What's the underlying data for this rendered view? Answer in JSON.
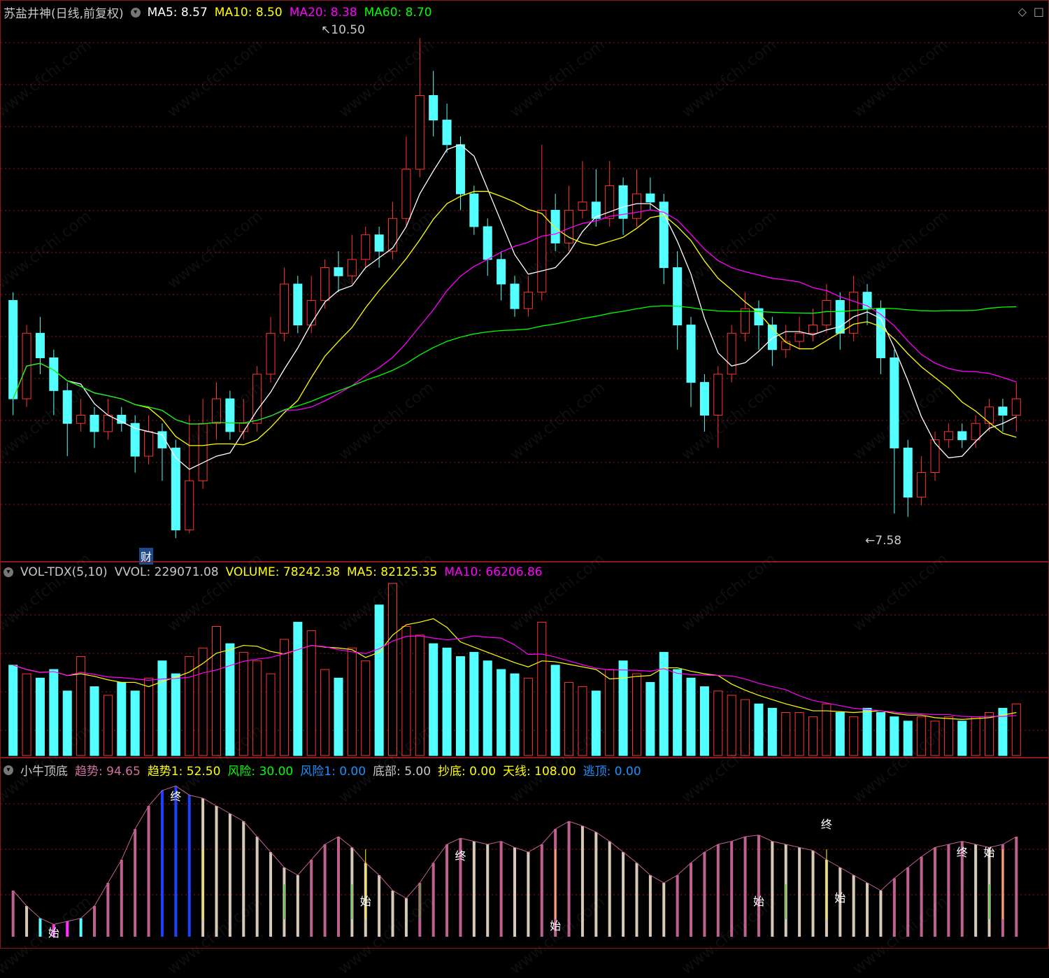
{
  "price_panel": {
    "title": "苏盐井神(日线,前复权)",
    "ma": [
      {
        "label": "MA5:",
        "value": "8.57",
        "color": "#ffffff"
      },
      {
        "label": "MA10:",
        "value": "8.50",
        "color": "#ffff00"
      },
      {
        "label": "MA20:",
        "value": "8.38",
        "color": "#ff00ff"
      },
      {
        "label": "MA60:",
        "value": "8.70",
        "color": "#00ff00"
      }
    ],
    "high_label": "10.50",
    "low_label": "7.58",
    "marker_cai": "财"
  },
  "vol_panel": {
    "title": "VOL-TDX(5,10)",
    "items": [
      {
        "label": "VVOL:",
        "value": "229071.08",
        "color": "#c8c8c8"
      },
      {
        "label": "VOLUME:",
        "value": "78242.38",
        "color": "#ffff00"
      },
      {
        "label": "MA5:",
        "value": "82125.35",
        "color": "#ffff00"
      },
      {
        "label": "MA10:",
        "value": "66206.86",
        "color": "#ff00ff"
      }
    ]
  },
  "ind_panel": {
    "title": "小牛顶底",
    "items": [
      {
        "label": "趋势:",
        "value": "94.65",
        "color": "#d070a0"
      },
      {
        "label": "趋势1:",
        "value": "52.50",
        "color": "#ffff00"
      },
      {
        "label": "风险:",
        "value": "30.00",
        "color": "#00ff00"
      },
      {
        "label": "风险1:",
        "value": "0.00",
        "color": "#1e90ff"
      },
      {
        "label": "底部:",
        "value": "5.00",
        "color": "#c8c8c8"
      },
      {
        "label": "抄底:",
        "value": "0.00",
        "color": "#ffff00"
      },
      {
        "label": "天线:",
        "value": "108.00",
        "color": "#ffff00"
      },
      {
        "label": "逃顶:",
        "value": "0.00",
        "color": "#1e90ff"
      }
    ],
    "marker_start": "始",
    "marker_end": "终"
  },
  "watermark": "www.cfchi.com",
  "colors": {
    "up": "#ff3232",
    "down": "#54ffff",
    "grid": "#8b1a1a"
  },
  "chart_data": {
    "type": "candlestick",
    "ylim": [
      7.4,
      10.6
    ],
    "candles": [
      [
        8.9,
        8.3,
        8.95,
        8.2
      ],
      [
        8.3,
        8.7,
        8.75,
        8.25
      ],
      [
        8.7,
        8.55,
        8.8,
        8.45
      ],
      [
        8.55,
        8.35,
        8.6,
        8.2
      ],
      [
        8.35,
        8.15,
        8.4,
        7.95
      ],
      [
        8.15,
        8.2,
        8.3,
        8.1
      ],
      [
        8.2,
        8.1,
        8.25,
        8.0
      ],
      [
        8.1,
        8.2,
        8.3,
        8.05
      ],
      [
        8.2,
        8.15,
        8.25,
        8.1
      ],
      [
        8.15,
        7.95,
        8.2,
        7.85
      ],
      [
        7.95,
        8.1,
        8.2,
        7.9
      ],
      [
        8.1,
        8.0,
        8.15,
        7.8
      ],
      [
        8.0,
        7.5,
        8.05,
        7.45
      ],
      [
        7.5,
        7.8,
        8.2,
        7.48
      ],
      [
        7.8,
        8.15,
        8.3,
        7.75
      ],
      [
        8.15,
        8.3,
        8.4,
        8.05
      ],
      [
        8.3,
        8.1,
        8.35,
        8.05
      ],
      [
        8.1,
        8.15,
        8.3,
        8.05
      ],
      [
        8.15,
        8.45,
        8.5,
        8.1
      ],
      [
        8.45,
        8.7,
        8.8,
        8.4
      ],
      [
        8.7,
        9.0,
        9.1,
        8.65
      ],
      [
        9.0,
        8.75,
        9.05,
        8.7
      ],
      [
        8.75,
        8.9,
        9.05,
        8.7
      ],
      [
        8.9,
        9.1,
        9.15,
        8.85
      ],
      [
        9.1,
        9.05,
        9.2,
        8.95
      ],
      [
        9.05,
        9.15,
        9.3,
        9.0
      ],
      [
        9.15,
        9.3,
        9.35,
        9.1
      ],
      [
        9.3,
        9.2,
        9.35,
        9.1
      ],
      [
        9.2,
        9.4,
        9.5,
        9.15
      ],
      [
        9.4,
        9.7,
        9.9,
        9.35
      ],
      [
        9.7,
        10.15,
        10.5,
        9.65
      ],
      [
        10.15,
        10.0,
        10.3,
        9.9
      ],
      [
        10.0,
        9.85,
        10.1,
        9.8
      ],
      [
        9.85,
        9.55,
        9.9,
        9.45
      ],
      [
        9.55,
        9.35,
        9.6,
        9.3
      ],
      [
        9.35,
        9.15,
        9.4,
        9.05
      ],
      [
        9.15,
        9.0,
        9.2,
        8.9
      ],
      [
        9.0,
        8.85,
        9.05,
        8.8
      ],
      [
        8.85,
        8.95,
        9.05,
        8.8
      ],
      [
        8.95,
        9.45,
        9.85,
        8.9
      ],
      [
        9.45,
        9.25,
        9.55,
        9.2
      ],
      [
        9.25,
        9.45,
        9.6,
        9.2
      ],
      [
        9.45,
        9.5,
        9.75,
        9.4
      ],
      [
        9.5,
        9.4,
        9.7,
        9.35
      ],
      [
        9.4,
        9.6,
        9.75,
        9.35
      ],
      [
        9.6,
        9.4,
        9.65,
        9.3
      ],
      [
        9.4,
        9.55,
        9.7,
        9.35
      ],
      [
        9.55,
        9.5,
        9.65,
        9.45
      ],
      [
        9.5,
        9.1,
        9.55,
        9.0
      ],
      [
        9.1,
        8.75,
        9.2,
        8.6
      ],
      [
        8.75,
        8.4,
        8.8,
        8.25
      ],
      [
        8.4,
        8.2,
        8.45,
        8.1
      ],
      [
        8.2,
        8.45,
        8.5,
        8.0
      ],
      [
        8.45,
        8.7,
        8.75,
        8.4
      ],
      [
        8.7,
        8.85,
        8.95,
        8.65
      ],
      [
        8.85,
        8.75,
        8.9,
        8.6
      ],
      [
        8.75,
        8.6,
        8.8,
        8.5
      ],
      [
        8.6,
        8.65,
        8.75,
        8.55
      ],
      [
        8.65,
        8.7,
        8.8,
        8.6
      ],
      [
        8.7,
        8.75,
        8.85,
        8.65
      ],
      [
        8.75,
        8.9,
        9.0,
        8.7
      ],
      [
        8.9,
        8.7,
        8.95,
        8.6
      ],
      [
        8.7,
        8.95,
        9.05,
        8.65
      ],
      [
        8.95,
        8.85,
        9.0,
        8.75
      ],
      [
        8.85,
        8.55,
        8.9,
        8.45
      ],
      [
        8.55,
        8.0,
        8.6,
        7.6
      ],
      [
        8.0,
        7.7,
        8.05,
        7.58
      ],
      [
        7.7,
        7.85,
        7.95,
        7.65
      ],
      [
        7.85,
        8.05,
        8.1,
        7.8
      ],
      [
        8.05,
        8.1,
        8.15,
        8.0
      ],
      [
        8.1,
        8.05,
        8.15,
        8.0
      ],
      [
        8.05,
        8.15,
        8.2,
        8.0
      ],
      [
        8.15,
        8.25,
        8.3,
        8.1
      ],
      [
        8.25,
        8.2,
        8.3,
        8.1
      ],
      [
        8.2,
        8.3,
        8.4,
        8.1
      ]
    ],
    "vol_values": [
      42,
      38,
      36,
      40,
      30,
      46,
      32,
      28,
      34,
      30,
      36,
      44,
      38,
      46,
      50,
      60,
      52,
      48,
      44,
      38,
      54,
      62,
      58,
      40,
      36,
      50,
      44,
      70,
      80,
      60,
      56,
      52,
      50,
      46,
      48,
      44,
      40,
      38,
      36,
      62,
      42,
      34,
      32,
      30,
      40,
      44,
      38,
      34,
      48,
      40,
      36,
      32,
      30,
      28,
      26,
      24,
      22,
      20,
      20,
      18,
      24,
      20,
      18,
      22,
      20,
      18,
      16,
      18,
      16,
      18,
      16,
      18,
      20,
      22,
      24
    ],
    "trend_values": [
      30,
      20,
      12,
      8,
      10,
      12,
      20,
      35,
      50,
      70,
      85,
      95,
      98,
      92,
      90,
      85,
      80,
      75,
      65,
      55,
      45,
      40,
      50,
      60,
      65,
      58,
      48,
      40,
      30,
      25,
      35,
      48,
      60,
      64,
      62,
      60,
      62,
      58,
      55,
      60,
      70,
      75,
      72,
      68,
      62,
      55,
      48,
      40,
      35,
      40,
      48,
      55,
      60,
      62,
      65,
      66,
      62,
      60,
      58,
      56,
      50,
      45,
      40,
      35,
      30,
      38,
      45,
      52,
      58,
      60,
      62,
      60,
      58,
      60,
      65
    ]
  }
}
